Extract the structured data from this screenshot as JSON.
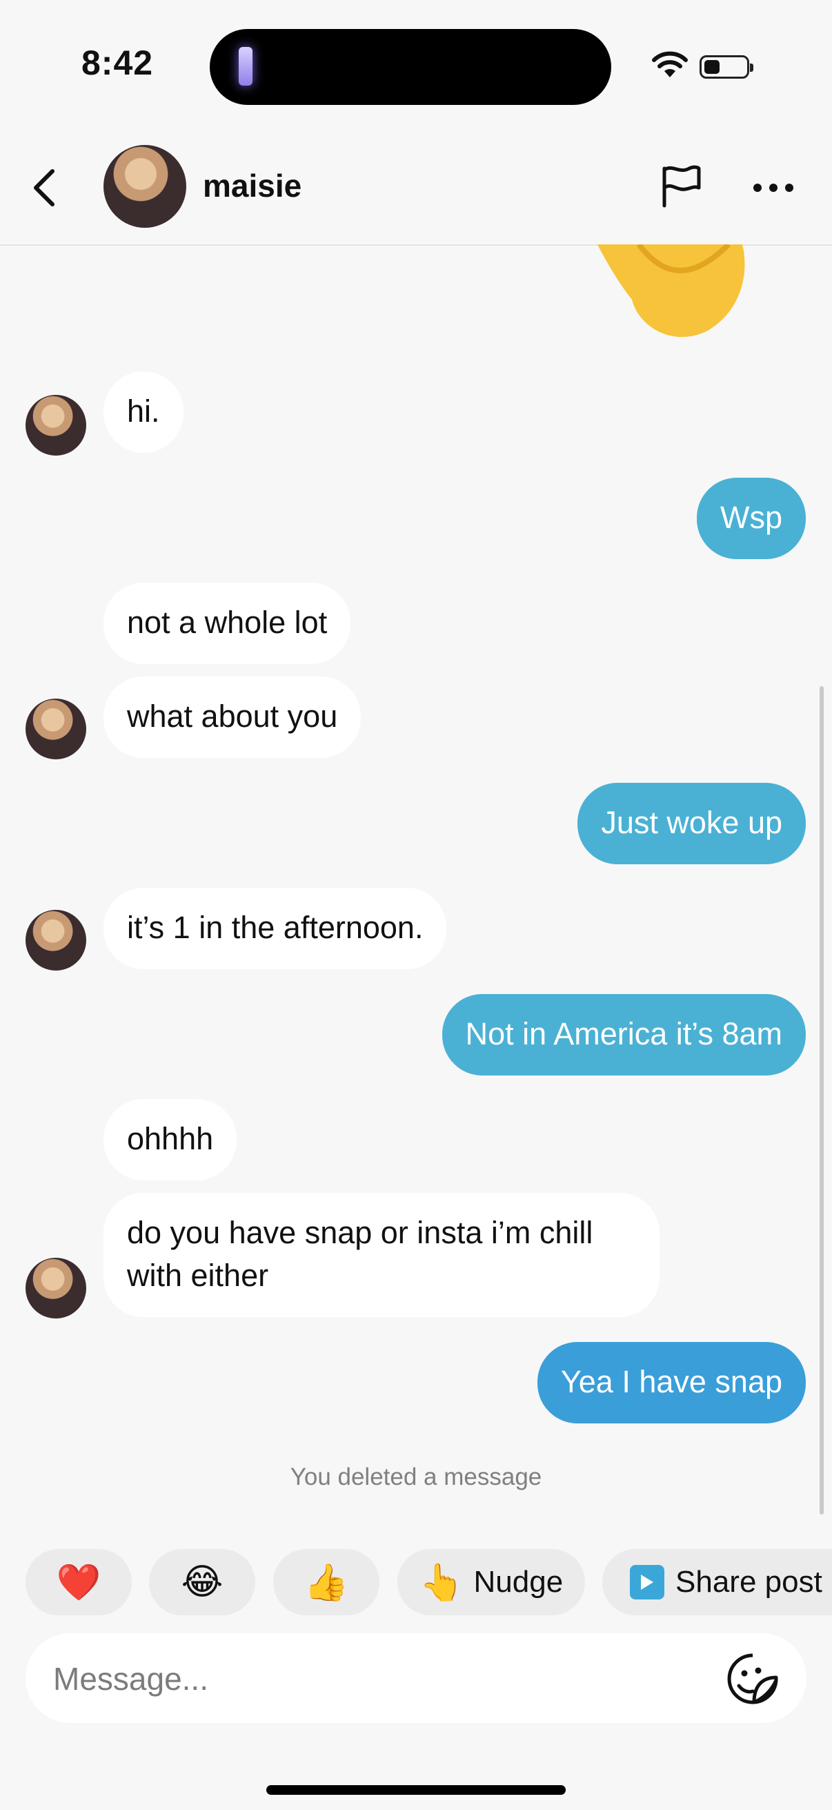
{
  "status_bar": {
    "time": "8:42"
  },
  "header": {
    "name": "maisie"
  },
  "messages": [
    {
      "text": "hi."
    },
    {
      "text": "Wsp"
    },
    {
      "text": "not a whole lot"
    },
    {
      "text": "what about you"
    },
    {
      "text": "Just woke up"
    },
    {
      "text": "it’s 1 in the afternoon."
    },
    {
      "text": "Not in America it’s 8am"
    },
    {
      "text": "ohhhh"
    },
    {
      "text": "do you have snap or insta i’m chill\nwith either"
    },
    {
      "text": "Yea I have snap"
    }
  ],
  "system_note": "You deleted a message",
  "reactions": {
    "heart": "❤️",
    "laugh": "😂",
    "thumbs": "👍",
    "nudge_emoji": "👆",
    "nudge_label": "Nudge",
    "share_label": "Share post"
  },
  "composer": {
    "placeholder": "Message..."
  },
  "colors": {
    "outgoing": "#4ab1d4",
    "outgoing_latest": "#3a9ed9",
    "incoming": "#ffffff"
  }
}
